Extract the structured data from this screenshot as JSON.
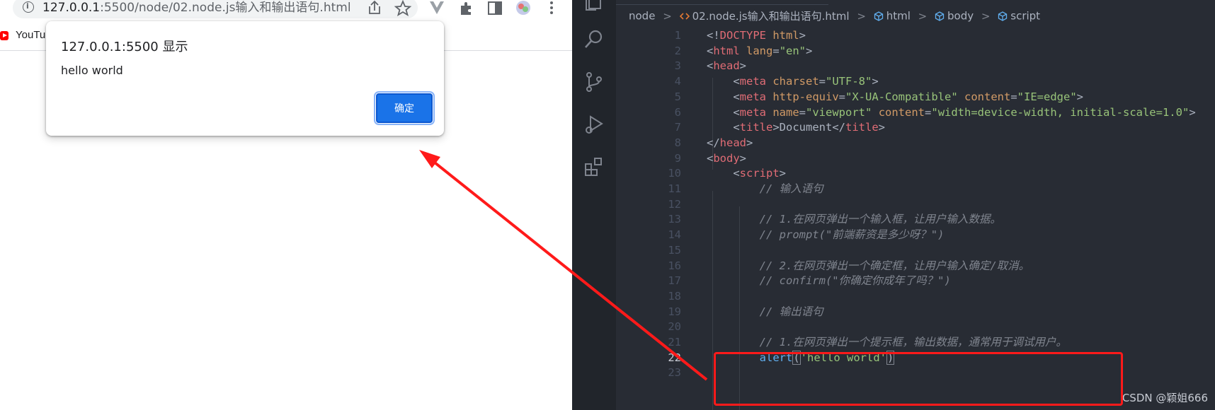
{
  "browser": {
    "url_host": "127.0.0.1",
    "url_rest": ":5500/node/02.node.js输入和输出语句.html",
    "bookmark_label": "YouTu",
    "dialog": {
      "title": "127.0.0.1:5500 显示",
      "message": "hello world",
      "ok_label": "确定"
    }
  },
  "editor": {
    "breadcrumb": [
      "node",
      "02.node.js输入和输出语句.html",
      "html",
      "body",
      "script"
    ],
    "active_line": 22,
    "lines": [
      {
        "n": "1",
        "html": "<span class=\"p\">&lt;!</span><span class=\"tg\">DOCTYPE</span> <span class=\"at\">html</span><span class=\"p\">&gt;</span>"
      },
      {
        "n": "2",
        "html": "<span class=\"p\">&lt;</span><span class=\"tg\">html</span> <span class=\"at\">lang</span><span class=\"p\">=</span><span class=\"st\">\"en\"</span><span class=\"p\">&gt;</span>"
      },
      {
        "n": "3",
        "html": "<span class=\"p\">&lt;</span><span class=\"tg\">head</span><span class=\"p\">&gt;</span>"
      },
      {
        "n": "4",
        "html": "    <span class=\"p\">&lt;</span><span class=\"tg\">meta</span> <span class=\"at\">charset</span><span class=\"p\">=</span><span class=\"st\">\"UTF-8\"</span><span class=\"p\">&gt;</span>"
      },
      {
        "n": "5",
        "html": "    <span class=\"p\">&lt;</span><span class=\"tg\">meta</span> <span class=\"at\">http-equiv</span><span class=\"p\">=</span><span class=\"st\">\"X-UA-Compatible\"</span> <span class=\"at\">content</span><span class=\"p\">=</span><span class=\"st\">\"IE=edge\"</span><span class=\"p\">&gt;</span>"
      },
      {
        "n": "6",
        "html": "    <span class=\"p\">&lt;</span><span class=\"tg\">meta</span> <span class=\"at\">name</span><span class=\"p\">=</span><span class=\"st\">\"viewport\"</span> <span class=\"at\">content</span><span class=\"p\">=</span><span class=\"st\">\"width=device-width, initial-scale=1.0\"</span><span class=\"p\">&gt;</span>"
      },
      {
        "n": "7",
        "html": "    <span class=\"p\">&lt;</span><span class=\"tg\">title</span><span class=\"p\">&gt;Document&lt;/</span><span class=\"tg\">title</span><span class=\"p\">&gt;</span>"
      },
      {
        "n": "8",
        "html": "<span class=\"p\">&lt;/</span><span class=\"tg\">head</span><span class=\"p\">&gt;</span>"
      },
      {
        "n": "9",
        "html": "<span class=\"p\">&lt;</span><span class=\"tg\">body</span><span class=\"p\">&gt;</span>"
      },
      {
        "n": "10",
        "html": "    <span class=\"p\">&lt;</span><span class=\"tg\">script</span><span class=\"p\">&gt;</span>"
      },
      {
        "n": "11",
        "html": "        <span class=\"cm\">// 输入语句</span>"
      },
      {
        "n": "12",
        "html": ""
      },
      {
        "n": "13",
        "html": "        <span class=\"cm\">// 1.在网页弹出一个输入框，让用户输入数据。</span>"
      },
      {
        "n": "14",
        "html": "        <span class=\"cm\">// prompt(\"前端薪资是多少呀？\")</span>"
      },
      {
        "n": "15",
        "html": ""
      },
      {
        "n": "16",
        "html": "        <span class=\"cm\">// 2.在网页弹出一个确定框，让用户输入确定/取消。</span>"
      },
      {
        "n": "17",
        "html": "        <span class=\"cm\">// confirm(\"你确定你成年了吗？\")</span>"
      },
      {
        "n": "18",
        "html": ""
      },
      {
        "n": "19",
        "html": "        <span class=\"cm\">// 输出语句</span>"
      },
      {
        "n": "20",
        "html": ""
      },
      {
        "n": "21",
        "html": "        <span class=\"cm\">// 1.在网页弹出一个提示框，输出数据，通常用于调试用户。</span>"
      },
      {
        "n": "22",
        "html": "        <span class=\"fn\">alert</span><span class=\"p\" id=\"bracket-hl\">(</span><span class=\"st\">'hello world'</span><span class=\"p\" id=\"bracket-hl\">)</span>"
      },
      {
        "n": "23",
        "html": ""
      }
    ]
  },
  "watermark": "CSDN @颖姐666",
  "colors": {
    "editor_bg": "#282c34",
    "activity_bar_bg": "#21252b",
    "dialog_button": "#1a73e8",
    "annotation_red": "#ff1a1a"
  }
}
